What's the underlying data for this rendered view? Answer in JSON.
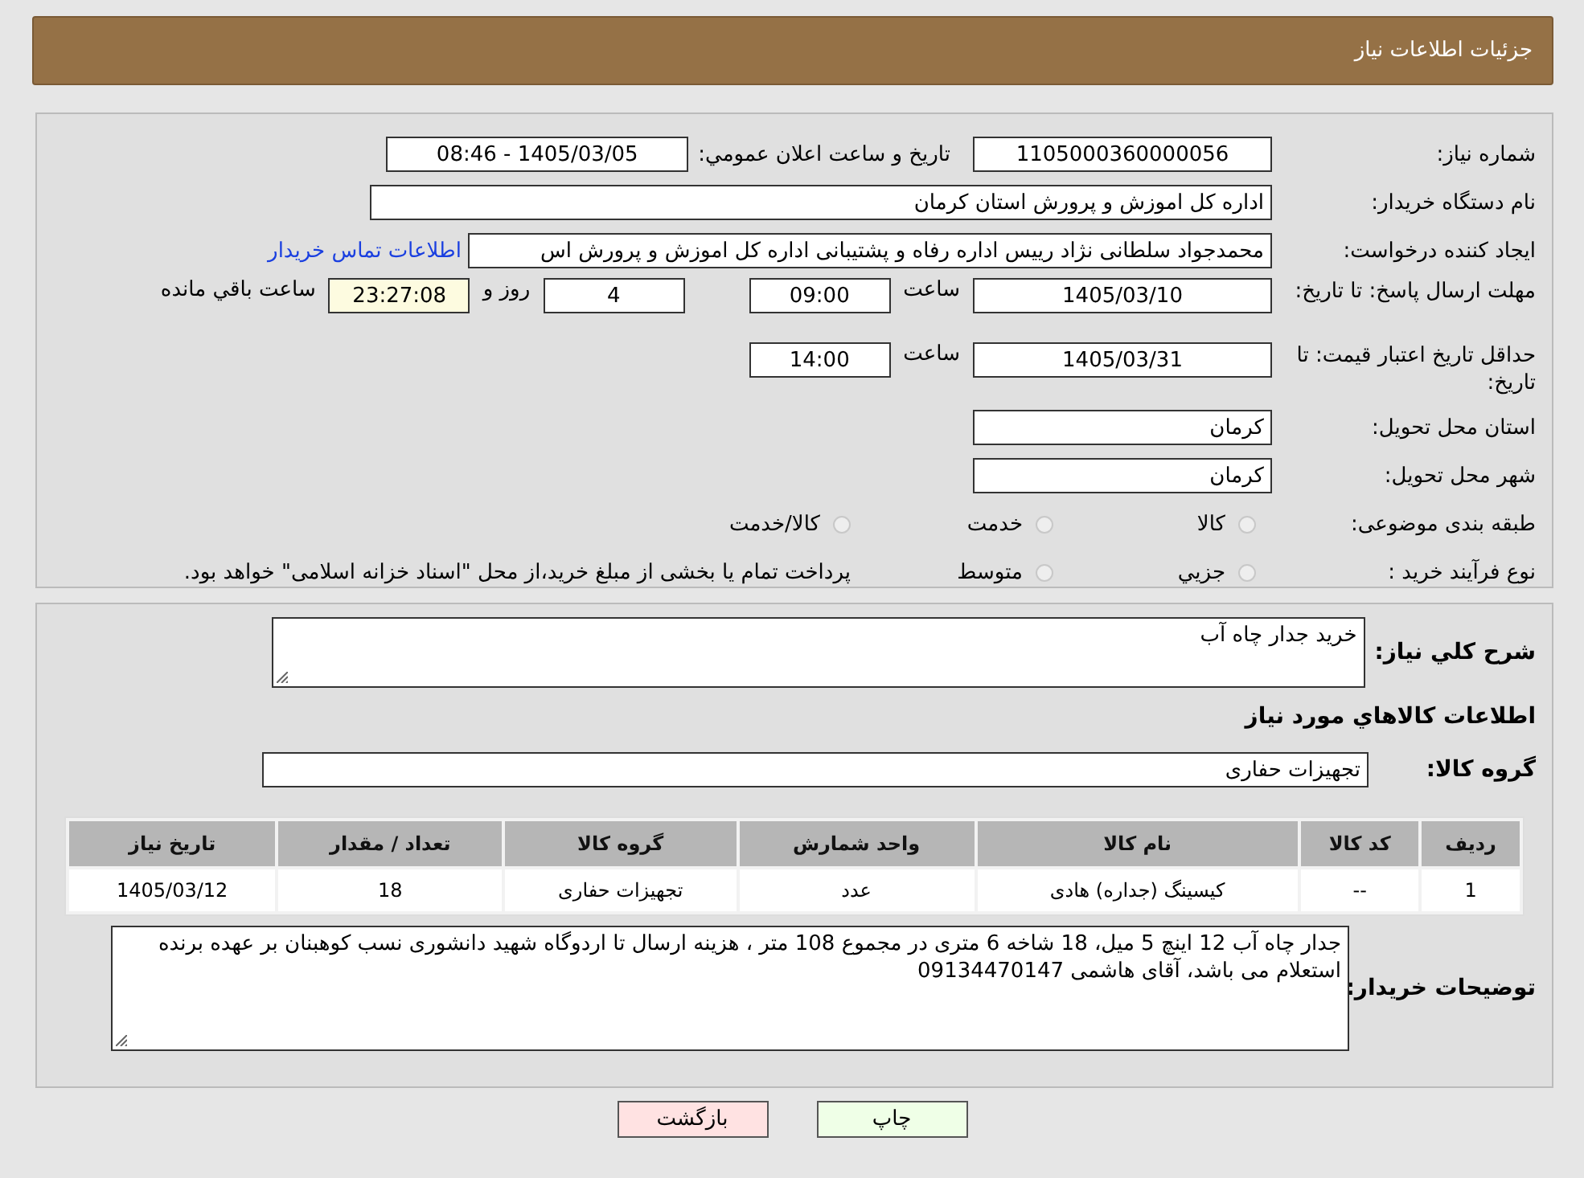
{
  "page_title": "جزئیات اطلاعات نیاز",
  "need_number": {
    "label": "شماره نیاز:",
    "value": "1105000360000056"
  },
  "announce": {
    "label": "تاریخ و ساعت اعلان عمومي:",
    "value": "1405/03/05 - 08:46"
  },
  "buyer_org": {
    "label": "نام دستگاه خریدار:",
    "value": "اداره کل اموزش و پرورش استان کرمان"
  },
  "requester": {
    "label": "ایجاد کننده درخواست:",
    "value": "محمدجواد سلطانی نژاد رییس اداره رفاه و پشتیبانی اداره کل اموزش و پرورش اس",
    "link": "اطلاعات تماس خریدار"
  },
  "reply_deadline": {
    "label": "مهلت ارسال پاسخ: تا تاریخ:",
    "date": "1405/03/10",
    "time_label": "ساعت",
    "time": "09:00",
    "days": "4",
    "days_label": "روز و",
    "remaining": "23:27:08",
    "remaining_label": "ساعت باقي مانده"
  },
  "price_validity": {
    "label": "حداقل تاریخ اعتبار قیمت: تا تاریخ:",
    "date": "1405/03/31",
    "time_label": "ساعت",
    "time": "14:00"
  },
  "province": {
    "label": "استان محل تحویل:",
    "value": "کرمان"
  },
  "city": {
    "label": "شهر محل تحویل:",
    "value": "کرمان"
  },
  "category": {
    "label": "طبقه بندی موضوعی:",
    "options": [
      {
        "label": "كالا",
        "selected": false
      },
      {
        "label": "خدمت",
        "selected": false
      },
      {
        "label": "كالا/خدمت",
        "selected": false
      }
    ]
  },
  "purchase_type": {
    "label": "نوع فرآیند خرید :",
    "options": [
      {
        "label": "جزيي",
        "selected": false
      },
      {
        "label": "متوسط",
        "selected": false
      }
    ],
    "note": "پرداخت تمام یا بخشی از مبلغ خرید،از محل \"اسناد خزانه اسلامی\" خواهد بود."
  },
  "summary": {
    "label": "شرح كلي نياز:",
    "value": "خرید جدار چاه آب"
  },
  "items_heading": "اطلاعات كالاهاي مورد نياز",
  "goods_group": {
    "label": "گروه كالا:",
    "value": "تجهیزات حفاری"
  },
  "table": {
    "columns": [
      "رديف",
      "کد کالا",
      "نام کالا",
      "واحد شمارش",
      "گروه کالا",
      "تعداد / مقدار",
      "تاریخ نیاز"
    ],
    "rows": [
      [
        "1",
        "--",
        "کیسینگ (جداره) هادی",
        "عدد",
        "تجهیزات حفاری",
        "18",
        "1405/03/12"
      ]
    ]
  },
  "buyer_notes": {
    "label": "توضیحات خریدار:",
    "value": "جدار چاه آب 12 اینچ 5 میل، 18 شاخه 6 متری در مجموع 108 متر ، هزینه ارسال تا اردوگاه شهید دانشوری نسب کوهبنان بر عهده برنده استعلام می باشد، آقای هاشمی 09134470147"
  },
  "buttons": [
    {
      "label": "چاپ",
      "kind": "print"
    },
    {
      "label": "بازگشت",
      "kind": "back"
    }
  ]
}
